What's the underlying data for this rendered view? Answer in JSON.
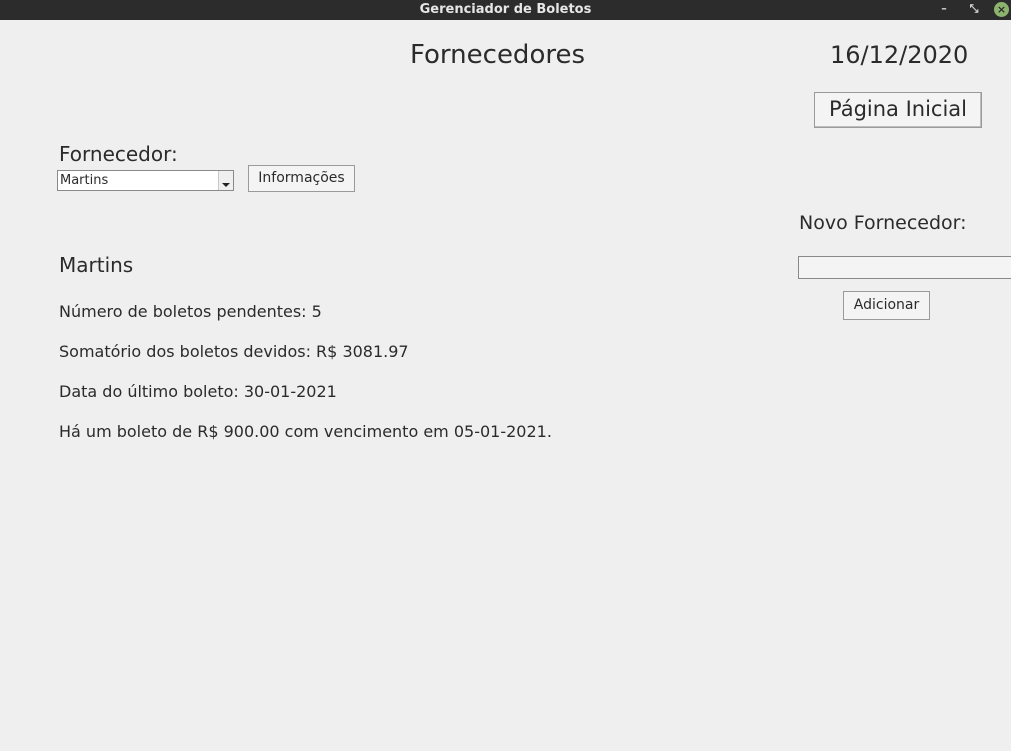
{
  "window": {
    "title": "Gerenciador de Boletos",
    "minimize_glyph": "–",
    "maximize_glyph": "⤡",
    "close_glyph": "×"
  },
  "header": {
    "title": "Fornecedores",
    "date": "16/12/2020",
    "home_button": "Página Inicial"
  },
  "supplier_select": {
    "label": "Fornecedor:",
    "value": "Martins",
    "info_button": "Informações"
  },
  "new_supplier": {
    "label": "Novo Fornecedor:",
    "value": "",
    "add_button": "Adicionar"
  },
  "details": {
    "name": "Martins",
    "pending": "Número de boletos pendentes: 5",
    "total": "Somatório dos boletos devidos: R$ 3081.97",
    "last_date": "Data do último boleto: 30-01-2021",
    "next_due": "Há um boleto de R$ 900.00 com vencimento em 05-01-2021."
  }
}
